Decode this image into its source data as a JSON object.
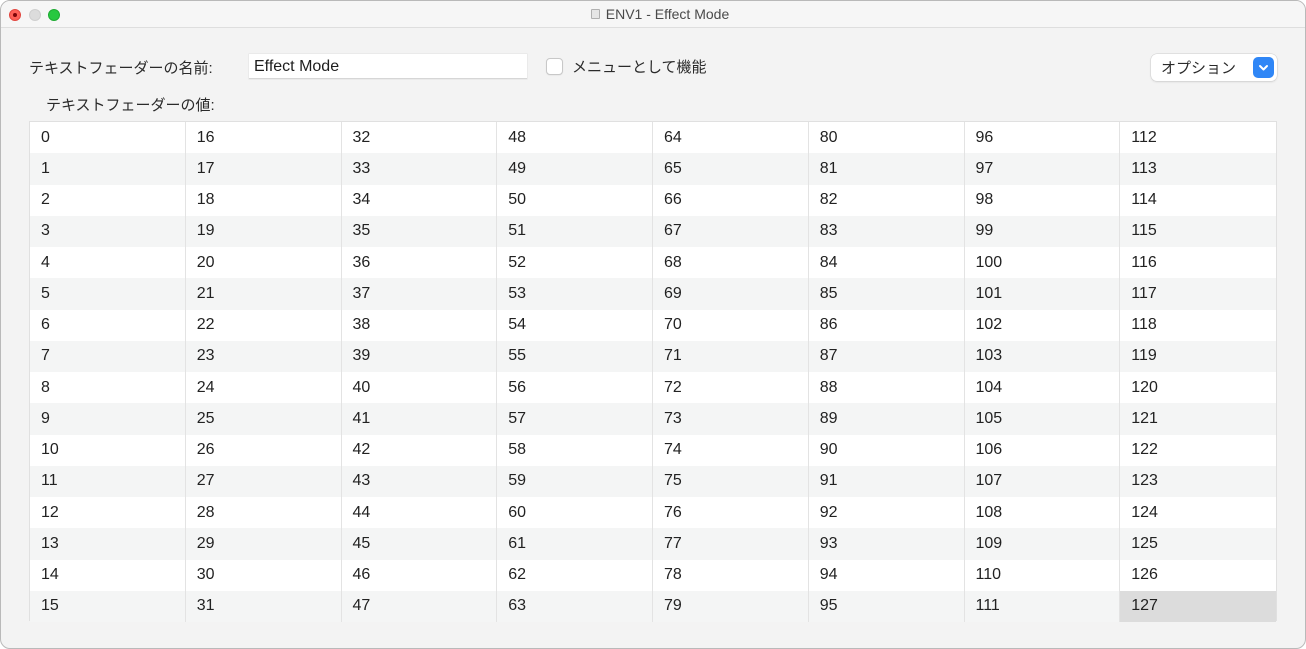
{
  "window": {
    "title": "ENV1 - Effect Mode",
    "document_icon": "document-proxy-icon",
    "traffic_lights": {
      "close": "close-icon",
      "minimize": "minimize-icon",
      "zoom": "zoom-icon"
    }
  },
  "form": {
    "name_label": "テキストフェーダーの名前:",
    "name_value": "Effect Mode",
    "menu_checkbox": {
      "label": "メニューとして機能",
      "checked": false
    },
    "options_button": {
      "label": "オプション",
      "icon": "chevron-down-icon"
    },
    "values_label": "テキストフェーダーの値:"
  },
  "colors": {
    "accent": "#2f86f6",
    "row_alt": "#f4f5f5",
    "selected_cell": "#dcdcdc",
    "close": "#fe5f57",
    "zoom": "#28c840"
  },
  "grid": {
    "columns": 8,
    "rows": 16,
    "selected_value": "127",
    "cells": [
      [
        "0",
        "16",
        "32",
        "48",
        "64",
        "80",
        "96",
        "112"
      ],
      [
        "1",
        "17",
        "33",
        "49",
        "65",
        "81",
        "97",
        "113"
      ],
      [
        "2",
        "18",
        "34",
        "50",
        "66",
        "82",
        "98",
        "114"
      ],
      [
        "3",
        "19",
        "35",
        "51",
        "67",
        "83",
        "99",
        "115"
      ],
      [
        "4",
        "20",
        "36",
        "52",
        "68",
        "84",
        "100",
        "116"
      ],
      [
        "5",
        "21",
        "37",
        "53",
        "69",
        "85",
        "101",
        "117"
      ],
      [
        "6",
        "22",
        "38",
        "54",
        "70",
        "86",
        "102",
        "118"
      ],
      [
        "7",
        "23",
        "39",
        "55",
        "71",
        "87",
        "103",
        "119"
      ],
      [
        "8",
        "24",
        "40",
        "56",
        "72",
        "88",
        "104",
        "120"
      ],
      [
        "9",
        "25",
        "41",
        "57",
        "73",
        "89",
        "105",
        "121"
      ],
      [
        "10",
        "26",
        "42",
        "58",
        "74",
        "90",
        "106",
        "122"
      ],
      [
        "11",
        "27",
        "43",
        "59",
        "75",
        "91",
        "107",
        "123"
      ],
      [
        "12",
        "28",
        "44",
        "60",
        "76",
        "92",
        "108",
        "124"
      ],
      [
        "13",
        "29",
        "45",
        "61",
        "77",
        "93",
        "109",
        "125"
      ],
      [
        "14",
        "30",
        "46",
        "62",
        "78",
        "94",
        "110",
        "126"
      ],
      [
        "15",
        "31",
        "47",
        "63",
        "79",
        "95",
        "111",
        "127"
      ]
    ]
  }
}
